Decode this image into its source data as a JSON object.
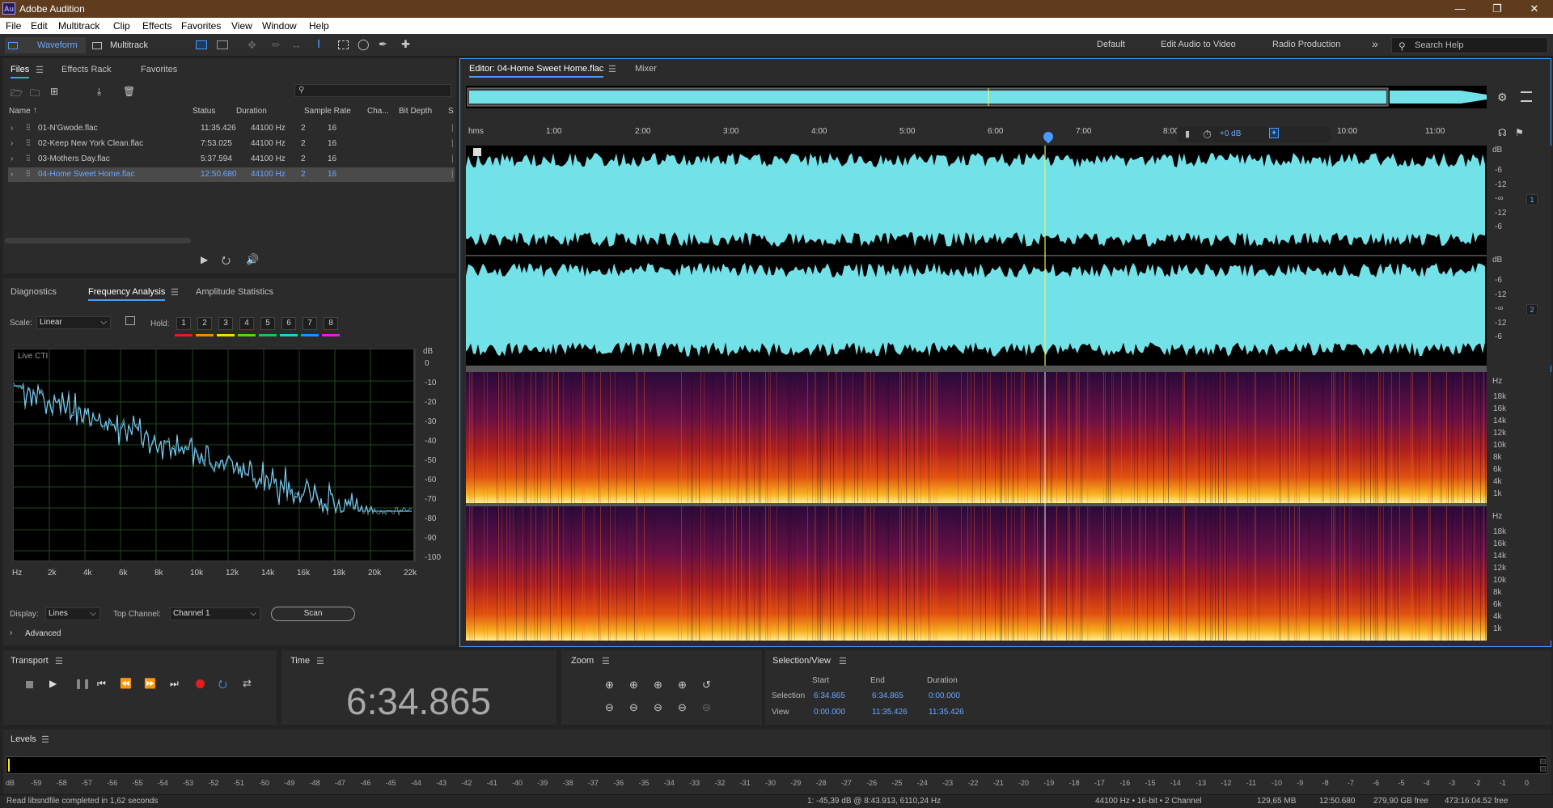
{
  "app": {
    "title": "Adobe Audition",
    "logo": "Au"
  },
  "menu": [
    "File",
    "Edit",
    "Multitrack",
    "Clip",
    "Effects",
    "Favorites",
    "View",
    "Window",
    "Help"
  ],
  "toolbar": {
    "waveform": "Waveform",
    "multitrack": "Multitrack",
    "workspaces": [
      "Default",
      "Edit Audio to Video",
      "Radio Production"
    ],
    "more": "»",
    "search_placeholder": "Search Help"
  },
  "files_panel": {
    "tabs": [
      "Files",
      "Effects Rack",
      "Favorites"
    ],
    "columns": [
      "Name",
      "Status",
      "Duration",
      "Sample Rate",
      "Cha...",
      "Bit Depth",
      "S"
    ],
    "rows": [
      {
        "name": "01-N'Gwode.flac",
        "status": "",
        "duration": "11:35.426",
        "rate": "44100 Hz",
        "ch": "2",
        "bits": "16",
        "selected": false
      },
      {
        "name": "02-Keep New York Clean.flac",
        "status": "",
        "duration": "7:53.025",
        "rate": "44100 Hz",
        "ch": "2",
        "bits": "16",
        "selected": false
      },
      {
        "name": "03-Mothers Day.flac",
        "status": "",
        "duration": "5:37.594",
        "rate": "44100 Hz",
        "ch": "2",
        "bits": "16",
        "selected": false
      },
      {
        "name": "04-Home Sweet Home.flac",
        "status": "",
        "duration": "12:50.680",
        "rate": "44100 Hz",
        "ch": "2",
        "bits": "16",
        "selected": true
      }
    ]
  },
  "analysis_panel": {
    "tabs": [
      "Diagnostics",
      "Frequency Analysis",
      "Amplitude Statistics"
    ],
    "scale_label": "Scale:",
    "scale_value": "Linear",
    "hold_label": "Hold:",
    "hold": [
      "1",
      "2",
      "3",
      "4",
      "5",
      "6",
      "7",
      "8"
    ],
    "hold_colors": [
      "#e02020",
      "#f08a00",
      "#f0e000",
      "#60d020",
      "#20c060",
      "#20d0d0",
      "#2090ff",
      "#e020e0"
    ],
    "live_label": "Live CTI",
    "db_unit": "dB",
    "db_ticks": [
      "0",
      "-10",
      "-20",
      "-30",
      "-40",
      "-50",
      "-60",
      "-70",
      "-80",
      "-90",
      "-100"
    ],
    "hz_ticks": [
      "Hz",
      "2k",
      "4k",
      "6k",
      "8k",
      "10k",
      "12k",
      "14k",
      "16k",
      "18k",
      "20k",
      "22k"
    ],
    "display_label": "Display:",
    "display_value": "Lines",
    "top_channel_label": "Top Channel:",
    "top_channel_value": "Channel 1",
    "scan": "Scan",
    "advanced": "Advanced"
  },
  "editor": {
    "tab": "Editor: 04-Home Sweet Home.flac",
    "mixer": "Mixer",
    "ruler": [
      "hms",
      "1:00",
      "2:00",
      "3:00",
      "4:00",
      "5:00",
      "6:00",
      "7:00",
      "8:00",
      "10:00",
      "11:00"
    ],
    "gain": "+0 dB",
    "db_unit": "dB",
    "db_labels": [
      "-6",
      "-12",
      "-∞",
      "-12",
      "-6"
    ],
    "ch1": "1",
    "ch2": "2",
    "hz_unit": "Hz",
    "hz_labels": [
      "18k",
      "16k",
      "14k",
      "12k",
      "10k",
      "8k",
      "6k",
      "4k",
      "1k"
    ],
    "waveform_color": "#73e2e8",
    "playhead_color": "#f0f060"
  },
  "transport": {
    "title": "Transport"
  },
  "time": {
    "title": "Time",
    "value": "6:34.865"
  },
  "zoom": {
    "title": "Zoom"
  },
  "selview": {
    "title": "Selection/View",
    "headers": [
      "Start",
      "End",
      "Duration"
    ],
    "selection_label": "Selection",
    "selection": [
      "6:34.865",
      "6:34.865",
      "0:00.000"
    ],
    "view_label": "View",
    "view": [
      "0:00.000",
      "11:35.426",
      "11:35.426"
    ]
  },
  "levels": {
    "title": "Levels",
    "ticks": [
      "dB",
      "-59",
      "-58",
      "-57",
      "-56",
      "-55",
      "-54",
      "-53",
      "-52",
      "-51",
      "-50",
      "-49",
      "-48",
      "-47",
      "-46",
      "-45",
      "-44",
      "-43",
      "-42",
      "-41",
      "-40",
      "-39",
      "-38",
      "-37",
      "-36",
      "-35",
      "-34",
      "-33",
      "-32",
      "-31",
      "-30",
      "-29",
      "-28",
      "-27",
      "-26",
      "-25",
      "-24",
      "-23",
      "-22",
      "-21",
      "-20",
      "-19",
      "-18",
      "-17",
      "-16",
      "-15",
      "-14",
      "-13",
      "-12",
      "-11",
      "-10",
      "-9",
      "-8",
      "-7",
      "-6",
      "-5",
      "-4",
      "-3",
      "-2",
      "-1",
      "0"
    ]
  },
  "status": {
    "message": "Read libsndfile completed in 1,62 seconds",
    "cursor": "1: -45,39 dB @ 8:43.913, 6110,24 Hz",
    "format": "44100 Hz • 16-bit • 2 Channel",
    "size": "129,65 MB",
    "duration": "12:50.680",
    "free": "279,90 GB free",
    "free_time": "473:16:04.52 free"
  }
}
